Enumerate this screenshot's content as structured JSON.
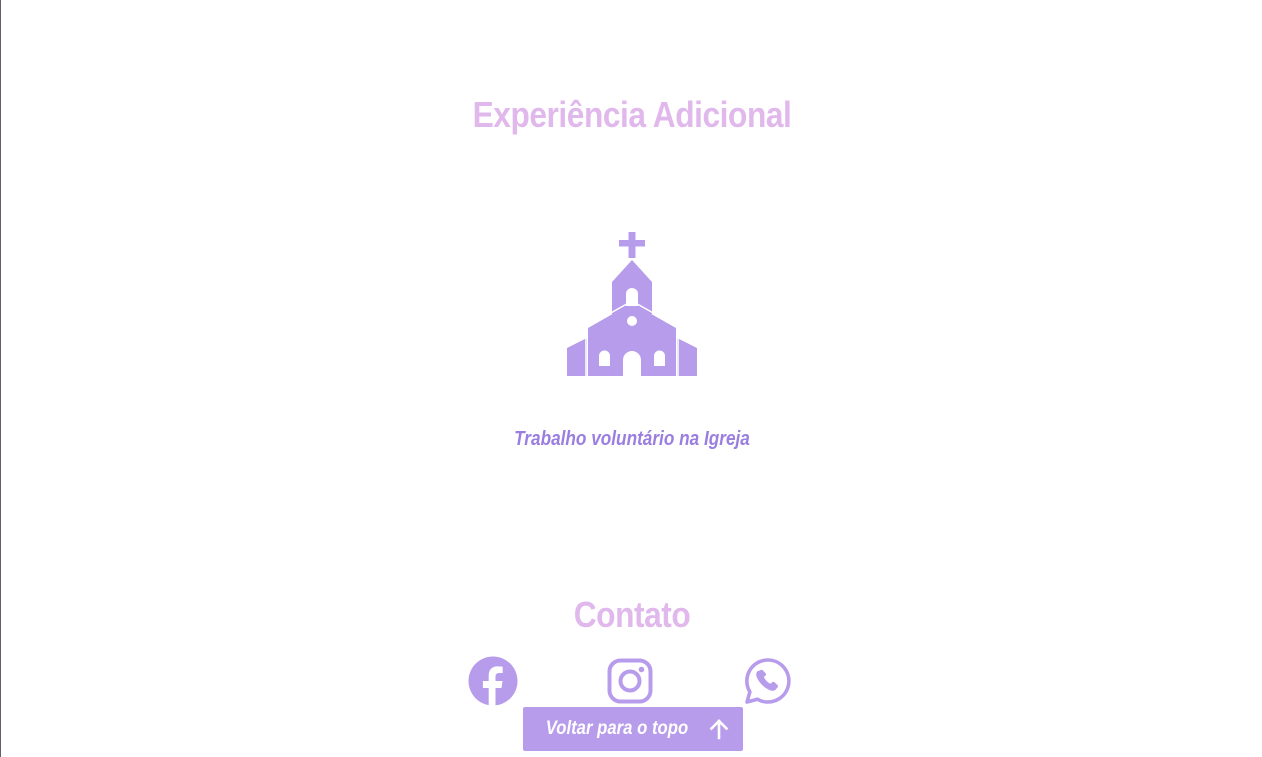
{
  "colors": {
    "title": "#e0b8ec",
    "accent": "#b89cec",
    "caption": "#9a7ee0",
    "button_bg": "#b89cec",
    "button_text": "#ffffff"
  },
  "experience": {
    "title": "Experiência Adicional",
    "item_icon": "church-icon",
    "item_label": "Trabalho voluntário na Igreja"
  },
  "contact": {
    "title": "Contato",
    "links": [
      {
        "icon": "facebook-icon"
      },
      {
        "icon": "instagram-icon"
      },
      {
        "icon": "whatsapp-icon"
      }
    ]
  },
  "back_to_top": {
    "label": "Voltar para o topo",
    "icon": "arrow-up-icon"
  }
}
